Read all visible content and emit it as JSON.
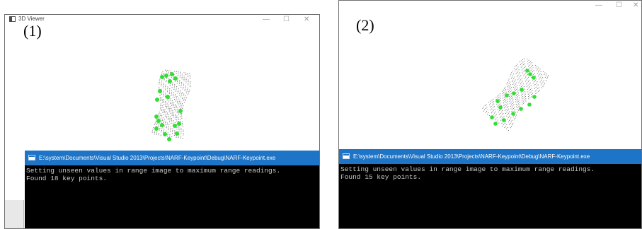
{
  "panel1": {
    "label": "(1)",
    "window_title": "3D Viewer",
    "controls": [
      "—",
      "☐",
      "✕"
    ],
    "console": {
      "title": "E:\\system\\Documents\\Visual Studio 2013\\Projects\\NARF-Keypoint\\Debug\\NARF-Keypoint.exe",
      "lines": [
        "Setting unseen values in range image to maximum range readings.",
        "Found 18 key points."
      ]
    },
    "keypoint_count": 18
  },
  "panel2": {
    "label": "(2)",
    "controls": [
      "—",
      "☐",
      "✕"
    ],
    "console": {
      "title": "E:\\system\\Documents\\Visual Studio 2013\\Projects\\NARF-Keypoint\\Debug\\NARF-Keypoint.exe",
      "lines": [
        "Setting unseen values in range image to maximum range readings.",
        "Found 15 key points."
      ]
    },
    "keypoint_count": 15
  },
  "colors": {
    "keypoint": "#33dd33",
    "cloud": "#5a5a5a",
    "console_title_bg": "#1e74c6",
    "console_bg": "#000000",
    "console_text": "#c8c8c8"
  }
}
